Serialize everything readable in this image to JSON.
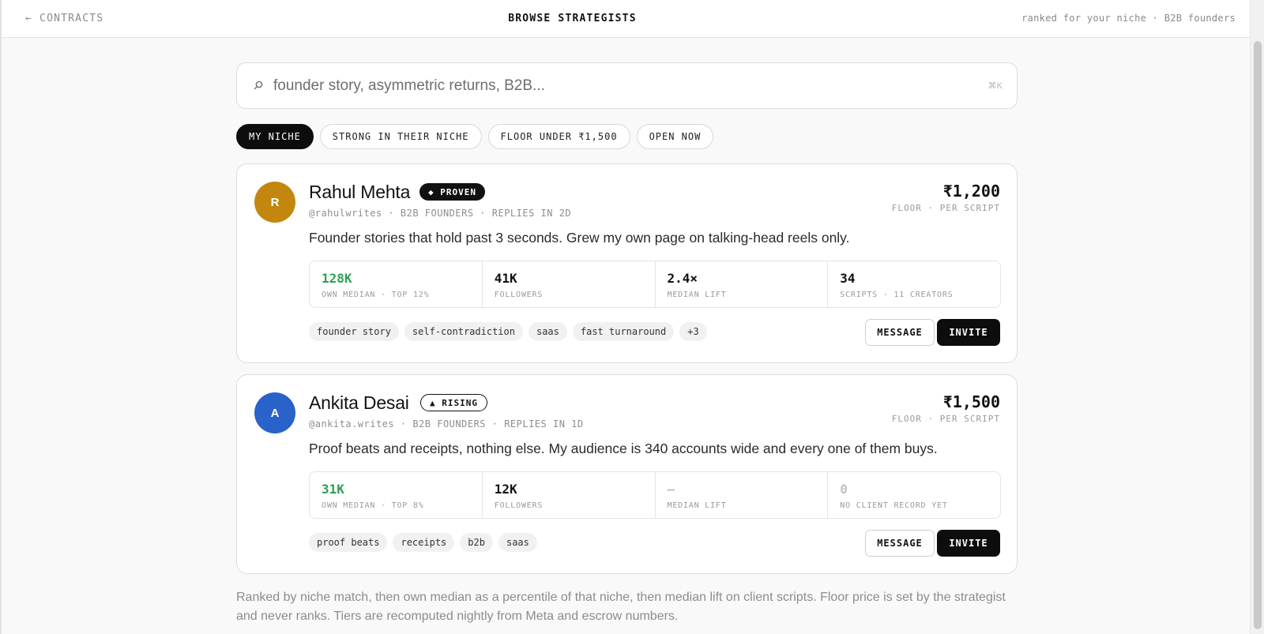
{
  "topbar": {
    "back_label": "← CONTRACTS",
    "title": "BROWSE STRATEGISTS",
    "ranked_note": "ranked for your niche · B2B founders"
  },
  "search": {
    "placeholder": "founder story, asymmetric returns, B2B...",
    "value": "",
    "shortcut": "⌘K",
    "icon": "search-icon"
  },
  "filters": [
    {
      "label": "MY NICHE",
      "active": true
    },
    {
      "label": "STRONG IN THEIR NICHE",
      "active": false
    },
    {
      "label": "FLOOR UNDER ₹1,500",
      "active": false
    },
    {
      "label": "OPEN NOW",
      "active": false
    }
  ],
  "cards": [
    {
      "initial": "R",
      "avatar_color": "#c3860f",
      "name": "Rahul Mehta",
      "badge": "◆ PROVEN",
      "badge_style": "solid",
      "meta": "@rahulwrites · B2B FOUNDERS · REPLIES IN 2D",
      "price": "₹1,200",
      "price_label": "FLOOR · PER SCRIPT",
      "bio": "Founder stories that hold past 3 seconds. Grew my own page on talking-head reels only.",
      "stats": [
        {
          "value": "128K",
          "label": "OWN MEDIAN · TOP 12%",
          "tone": "green"
        },
        {
          "value": "41K",
          "label": "FOLLOWERS",
          "tone": "default"
        },
        {
          "value": "2.4×",
          "label": "MEDIAN LIFT",
          "tone": "default"
        },
        {
          "value": "34",
          "label": "SCRIPTS · 11 CREATORS",
          "tone": "default"
        }
      ],
      "tags": [
        "founder story",
        "self-contradiction",
        "saas",
        "fast turnaround",
        "+3"
      ],
      "message_label": "MESSAGE",
      "invite_label": "INVITE"
    },
    {
      "initial": "A",
      "avatar_color": "#2962c9",
      "name": "Ankita Desai",
      "badge": "▲ RISING",
      "badge_style": "outline",
      "meta": "@ankita.writes · B2B FOUNDERS · REPLIES IN 1D",
      "price": "₹1,500",
      "price_label": "FLOOR · PER SCRIPT",
      "bio": "Proof beats and receipts, nothing else. My audience is 340 accounts wide and every one of them buys.",
      "stats": [
        {
          "value": "31K",
          "label": "OWN MEDIAN · TOP 8%",
          "tone": "green"
        },
        {
          "value": "12K",
          "label": "FOLLOWERS",
          "tone": "default"
        },
        {
          "value": "—",
          "label": "MEDIAN LIFT",
          "tone": "muted"
        },
        {
          "value": "0",
          "label": "NO CLIENT RECORD YET",
          "tone": "muted"
        }
      ],
      "tags": [
        "proof beats",
        "receipts",
        "b2b",
        "saas"
      ],
      "message_label": "MESSAGE",
      "invite_label": "INVITE"
    }
  ],
  "footnote": "Ranked by niche match, then own median as a percentile of that niche, then median lift on client scripts. Floor price is set by the strategist and never ranks. Tiers are recomputed nightly from Meta and escrow numbers."
}
